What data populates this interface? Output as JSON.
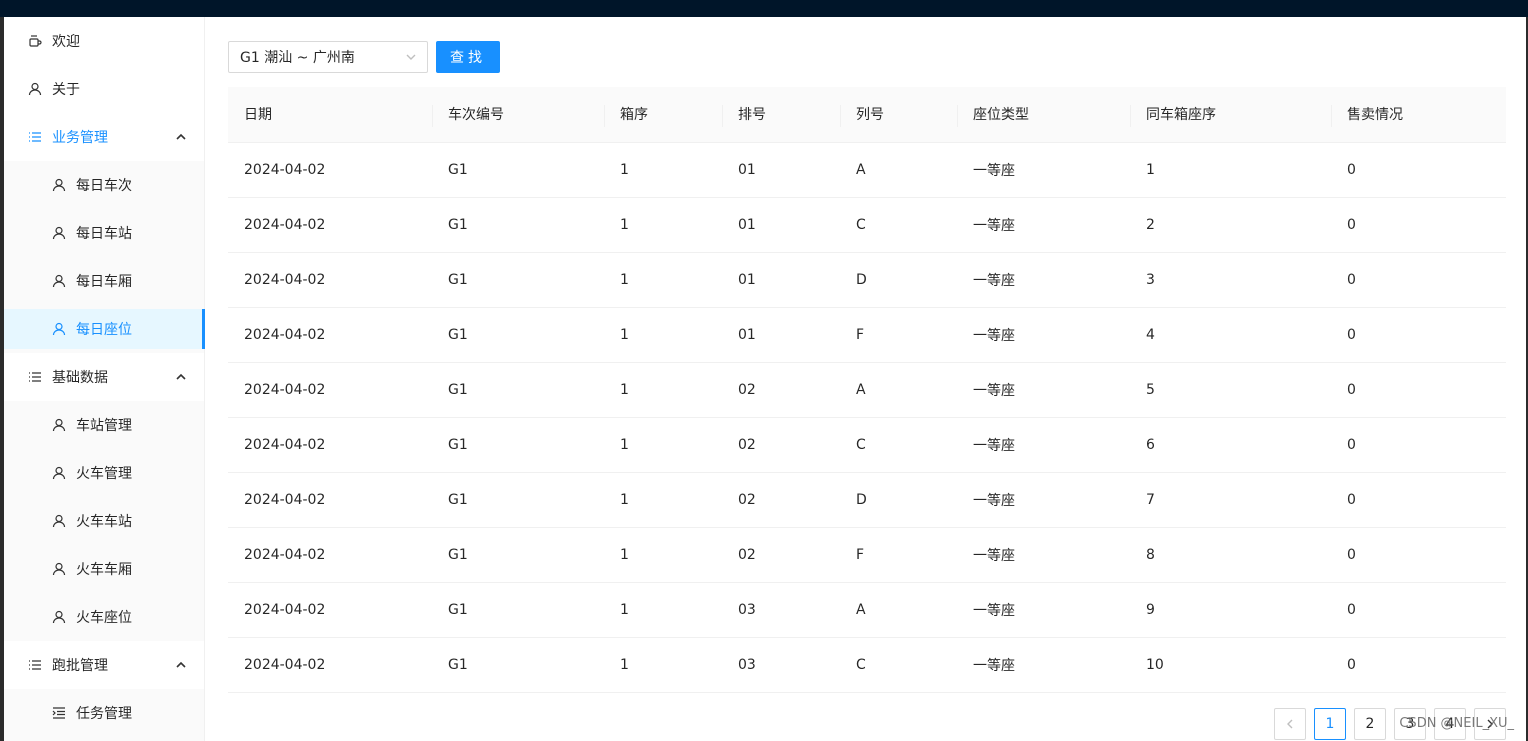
{
  "menu": {
    "welcome": "欢迎",
    "about": "关于",
    "groups": [
      {
        "title": "业务管理",
        "active": true,
        "items": [
          "每日车次",
          "每日车站",
          "每日车厢",
          "每日座位"
        ]
      },
      {
        "title": "基础数据",
        "active": false,
        "items": [
          "车站管理",
          "火车管理",
          "火车车站",
          "火车车厢",
          "火车座位"
        ]
      },
      {
        "title": "跑批管理",
        "active": false,
        "items": [
          "任务管理"
        ]
      }
    ],
    "selected_item": "每日座位"
  },
  "toolbar": {
    "train_select_value": "G1 潮汕 ~ 广州南",
    "search_label": "查找"
  },
  "table": {
    "columns": [
      "日期",
      "车次编号",
      "箱序",
      "排号",
      "列号",
      "座位类型",
      "同车箱座序",
      "售卖情况"
    ],
    "rows": [
      [
        "2024-04-02",
        "G1",
        "1",
        "01",
        "A",
        "一等座",
        "1",
        "0"
      ],
      [
        "2024-04-02",
        "G1",
        "1",
        "01",
        "C",
        "一等座",
        "2",
        "0"
      ],
      [
        "2024-04-02",
        "G1",
        "1",
        "01",
        "D",
        "一等座",
        "3",
        "0"
      ],
      [
        "2024-04-02",
        "G1",
        "1",
        "01",
        "F",
        "一等座",
        "4",
        "0"
      ],
      [
        "2024-04-02",
        "G1",
        "1",
        "02",
        "A",
        "一等座",
        "5",
        "0"
      ],
      [
        "2024-04-02",
        "G1",
        "1",
        "02",
        "C",
        "一等座",
        "6",
        "0"
      ],
      [
        "2024-04-02",
        "G1",
        "1",
        "02",
        "D",
        "一等座",
        "7",
        "0"
      ],
      [
        "2024-04-02",
        "G1",
        "1",
        "02",
        "F",
        "一等座",
        "8",
        "0"
      ],
      [
        "2024-04-02",
        "G1",
        "1",
        "03",
        "A",
        "一等座",
        "9",
        "0"
      ],
      [
        "2024-04-02",
        "G1",
        "1",
        "03",
        "C",
        "一等座",
        "10",
        "0"
      ]
    ]
  },
  "pagination": {
    "pages": [
      "1",
      "2",
      "3",
      "4"
    ],
    "current": "1"
  },
  "watermark": "CSDN @NEIL_XU_",
  "colors": {
    "header_bg": "#001529",
    "primary": "#1890ff",
    "selected_bg": "#e6f7ff"
  }
}
